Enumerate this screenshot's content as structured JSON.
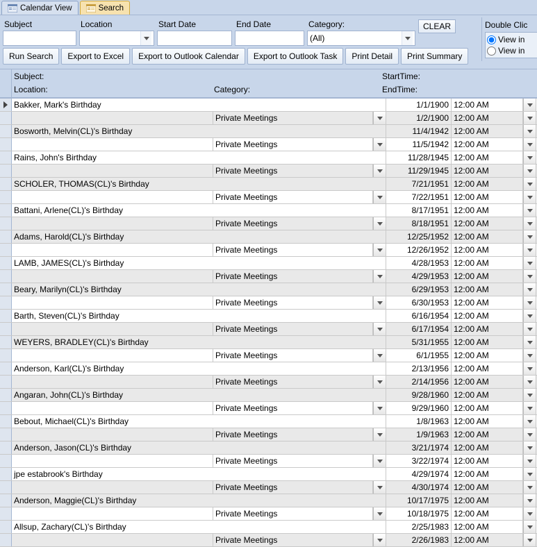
{
  "tabs": [
    {
      "label": "Calendar View",
      "active": false
    },
    {
      "label": "Search",
      "active": true
    }
  ],
  "filters": {
    "subject": {
      "label": "Subject",
      "value": ""
    },
    "location": {
      "label": "Location",
      "value": ""
    },
    "startdate": {
      "label": "Start Date",
      "value": ""
    },
    "enddate": {
      "label": "End Date",
      "value": ""
    },
    "category": {
      "label": "Category:",
      "value": "(All)"
    },
    "clear": "CLEAR"
  },
  "buttons": {
    "run": "Run Search",
    "excel": "Export to Excel",
    "outlook_cal": "Export to Outlook Calendar",
    "outlook_task": "Export to Outlook Task",
    "print_detail": "Print Detail",
    "print_summary": "Print Summary"
  },
  "rightpanel": {
    "header": "Double Clic",
    "opt1": "View in",
    "opt2": "View in"
  },
  "columns": {
    "subject": "Subject:",
    "location": "Location:",
    "category": "Category:",
    "starttime": "StartTime:",
    "endtime": "EndTime:"
  },
  "records": [
    {
      "subject": "Bakker, Mark's Birthday",
      "category": "Private Meetings",
      "sd": "1/1/1900",
      "st": "12:00 AM",
      "ed": "1/2/1900",
      "et": "12:00 AM"
    },
    {
      "subject": "Bosworth, Melvin(CL)'s Birthday",
      "category": "Private Meetings",
      "sd": "11/4/1942",
      "st": "12:00 AM",
      "ed": "11/5/1942",
      "et": "12:00 AM"
    },
    {
      "subject": "Rains, John's Birthday",
      "category": "Private Meetings",
      "sd": "11/28/1945",
      "st": "12:00 AM",
      "ed": "11/29/1945",
      "et": "12:00 AM"
    },
    {
      "subject": "SCHOLER, THOMAS(CL)'s Birthday",
      "category": "Private Meetings",
      "sd": "7/21/1951",
      "st": "12:00 AM",
      "ed": "7/22/1951",
      "et": "12:00 AM"
    },
    {
      "subject": "Battani, Arlene(CL)'s Birthday",
      "category": "Private Meetings",
      "sd": "8/17/1951",
      "st": "12:00 AM",
      "ed": "8/18/1951",
      "et": "12:00 AM"
    },
    {
      "subject": "Adams, Harold(CL)'s Birthday",
      "category": "Private Meetings",
      "sd": "12/25/1952",
      "st": "12:00 AM",
      "ed": "12/26/1952",
      "et": "12:00 AM"
    },
    {
      "subject": "LAMB, JAMES(CL)'s Birthday",
      "category": "Private Meetings",
      "sd": "4/28/1953",
      "st": "12:00 AM",
      "ed": "4/29/1953",
      "et": "12:00 AM"
    },
    {
      "subject": "Beary, Marilyn(CL)'s Birthday",
      "category": "Private Meetings",
      "sd": "6/29/1953",
      "st": "12:00 AM",
      "ed": "6/30/1953",
      "et": "12:00 AM"
    },
    {
      "subject": "Barth, Steven(CL)'s Birthday",
      "category": "Private Meetings",
      "sd": "6/16/1954",
      "st": "12:00 AM",
      "ed": "6/17/1954",
      "et": "12:00 AM"
    },
    {
      "subject": "WEYERS, BRADLEY(CL)'s Birthday",
      "category": "Private Meetings",
      "sd": "5/31/1955",
      "st": "12:00 AM",
      "ed": "6/1/1955",
      "et": "12:00 AM"
    },
    {
      "subject": "Anderson, Karl(CL)'s Birthday",
      "category": "Private Meetings",
      "sd": "2/13/1956",
      "st": "12:00 AM",
      "ed": "2/14/1956",
      "et": "12:00 AM"
    },
    {
      "subject": "Angaran, John(CL)'s Birthday",
      "category": "Private Meetings",
      "sd": "9/28/1960",
      "st": "12:00 AM",
      "ed": "9/29/1960",
      "et": "12:00 AM"
    },
    {
      "subject": "Bebout, Michael(CL)'s Birthday",
      "category": "Private Meetings",
      "sd": "1/8/1963",
      "st": "12:00 AM",
      "ed": "1/9/1963",
      "et": "12:00 AM"
    },
    {
      "subject": "Anderson, Jason(CL)'s Birthday",
      "category": "Private Meetings",
      "sd": "3/21/1974",
      "st": "12:00 AM",
      "ed": "3/22/1974",
      "et": "12:00 AM"
    },
    {
      "subject": "jpe estabrook's Birthday",
      "category": "Private Meetings",
      "sd": "4/29/1974",
      "st": "12:00 AM",
      "ed": "4/30/1974",
      "et": "12:00 AM"
    },
    {
      "subject": "Anderson, Maggie(CL)'s Birthday",
      "category": "Private Meetings",
      "sd": "10/17/1975",
      "st": "12:00 AM",
      "ed": "10/18/1975",
      "et": "12:00 AM"
    },
    {
      "subject": "Allsup, Zachary(CL)'s Birthday",
      "category": "Private Meetings",
      "sd": "2/25/1983",
      "st": "12:00 AM",
      "ed": "2/26/1983",
      "et": "12:00 AM"
    }
  ]
}
